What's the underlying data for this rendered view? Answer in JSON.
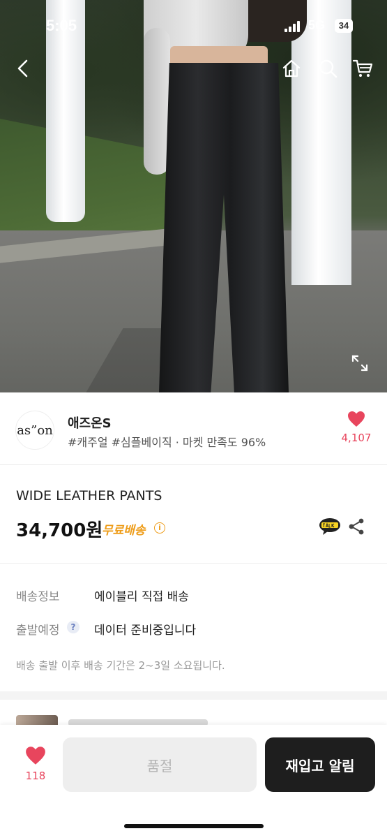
{
  "status_bar": {
    "time": "5:05",
    "network": "5G",
    "battery": "34"
  },
  "nav": {
    "back_icon": "chevron-left-icon",
    "home_icon": "home-icon",
    "search_icon": "search-icon",
    "cart_icon": "cart-icon"
  },
  "seller": {
    "logo_text": "as”on",
    "name": "애즈온S",
    "tags": "#캐주얼 #심플베이직 · 마켓 만족도 96%",
    "favorite_count": "4,107"
  },
  "product": {
    "title": "WIDE LEATHER PANTS",
    "price": "34,700원",
    "shipping_badge": "무료배송",
    "info_icon": "i"
  },
  "shipping": {
    "info_label": "배송정보",
    "info_value": "에이블리 직접 배송",
    "departure_label": "출발예정",
    "departure_value": "데이터 준비중입니다",
    "help_icon": "?",
    "note": "배송 출발 이후 배송 기간은 2~3일 소요됩니다."
  },
  "bottom_bar": {
    "favorite_count": "118",
    "soldout_label": "품절",
    "restock_label": "재입고 알림"
  },
  "colors": {
    "accent_heart": "#e8455d",
    "free_shipping": "#ee9d1a",
    "primary_button": "#1e1e1e"
  }
}
